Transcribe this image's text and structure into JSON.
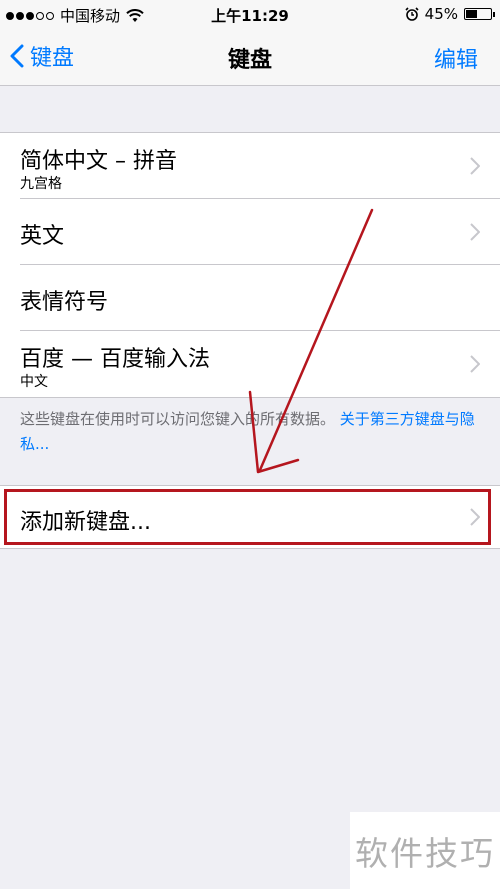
{
  "status_bar": {
    "carrier": "中国移动",
    "time": "上午11:29",
    "battery_percent": "45%",
    "battery_level": 0.45,
    "signal_filled": 3,
    "signal_total": 5
  },
  "nav": {
    "back_label": "键盘",
    "title": "键盘",
    "edit_label": "编辑"
  },
  "keyboards": [
    {
      "label": "简体中文 – 拼音",
      "sublabel": "九宫格",
      "has_chevron": true
    },
    {
      "label": "英文",
      "sublabel": "",
      "has_chevron": true
    },
    {
      "label": "表情符号",
      "sublabel": "",
      "has_chevron": false
    },
    {
      "label": "百度 — 百度输入法",
      "sublabel": "中文",
      "has_chevron": true
    }
  ],
  "footer": {
    "note": "这些键盘在使用时可以访问您键入的所有数据。",
    "link": "关于第三方键盘与隐私..."
  },
  "add_keyboard": {
    "label": "添加新键盘..."
  },
  "watermark": "软件技巧",
  "colors": {
    "accent": "#007aff",
    "annotation": "#b5161e",
    "background": "#efeff4"
  }
}
